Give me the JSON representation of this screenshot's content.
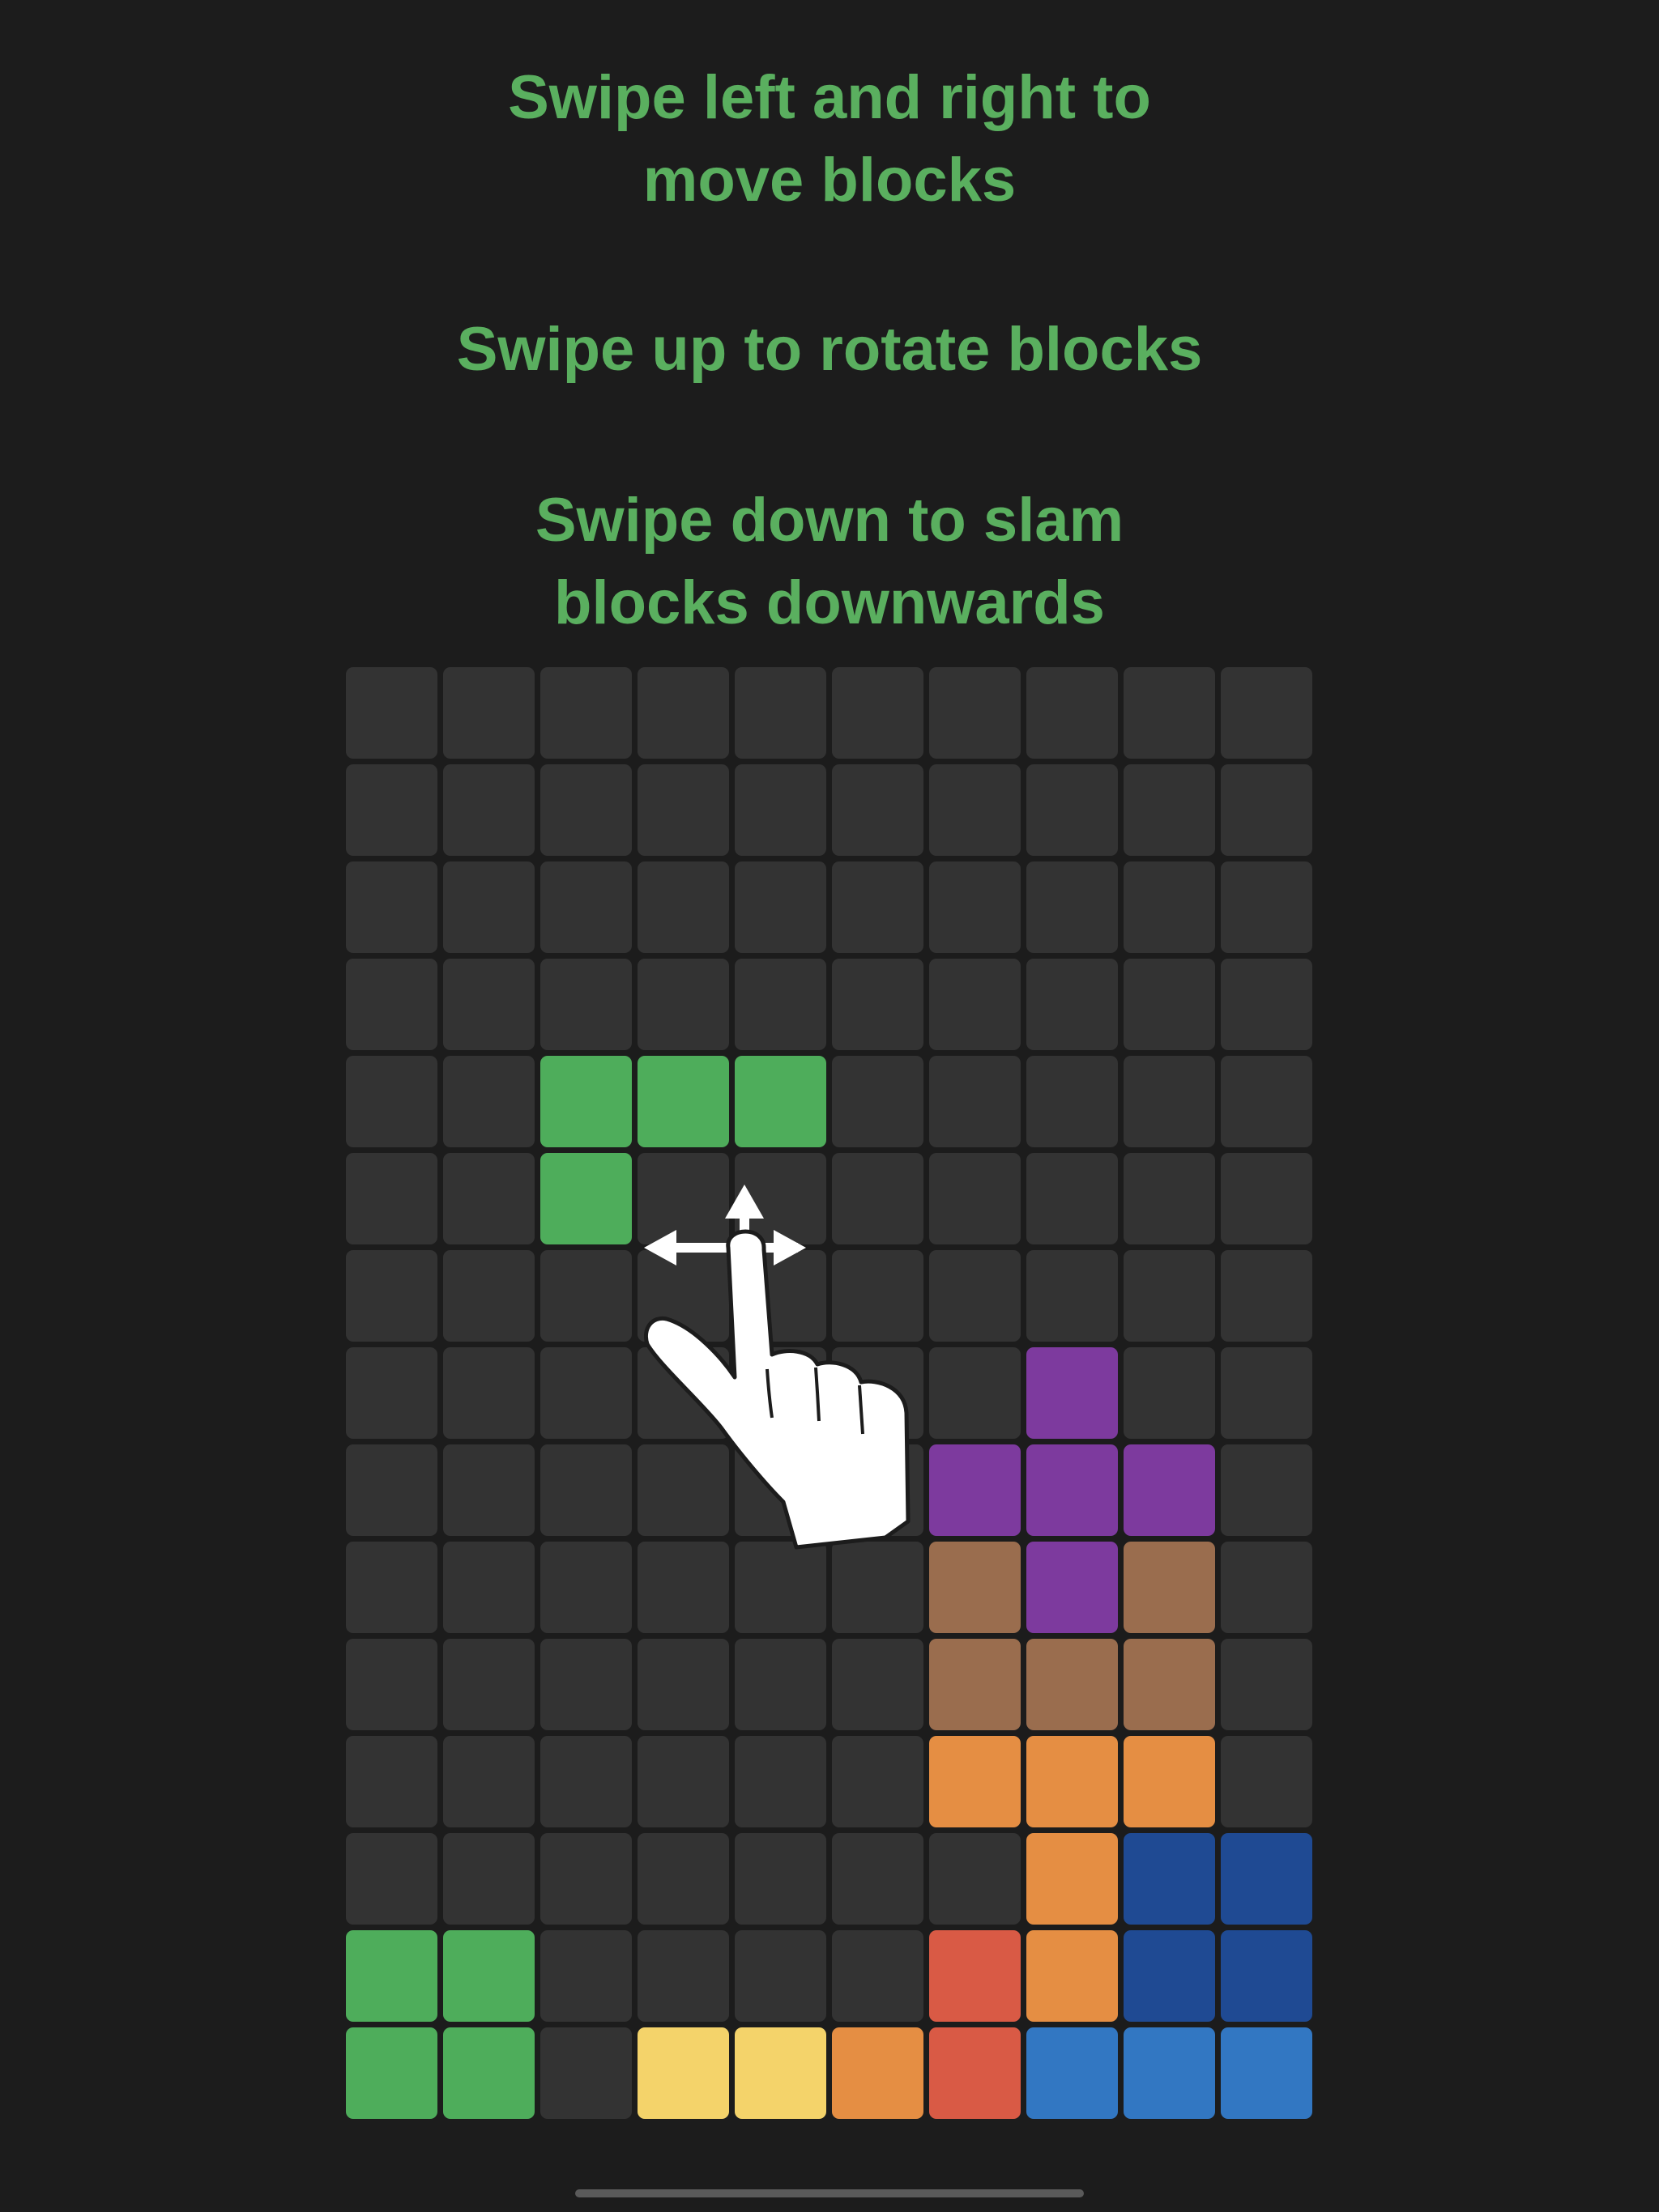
{
  "instructions": {
    "move": "Swipe left and right to\nmove blocks",
    "rotate": "Swipe up to rotate blocks",
    "slam": "Swipe down to slam\nblocks downwards"
  },
  "colors": {
    "background": "#1c1c1c",
    "text": "#5aaf5f",
    "empty": "#333333",
    "G": "#4ead5b",
    "P": "#7d3a9e",
    "B": "#9a6d4e",
    "O": "#e58e43",
    "N": "#1f4a93",
    "R": "#d95a45",
    "Y": "#f4d36a",
    "L": "#3277c2"
  },
  "board": {
    "columns": 10,
    "rows": 15,
    "grid": [
      "..........",
      "..........",
      "..........",
      "..........",
      "..GGG.....",
      "..G.......",
      "..........",
      ".......P..",
      "......PPP.",
      "......BPB.",
      "......BBB.",
      "......OOO.",
      ".......ONN",
      "GG....RONN",
      "GG.YYORLLL"
    ]
  },
  "gesture": {
    "icon": "swipe-hand-icon"
  }
}
